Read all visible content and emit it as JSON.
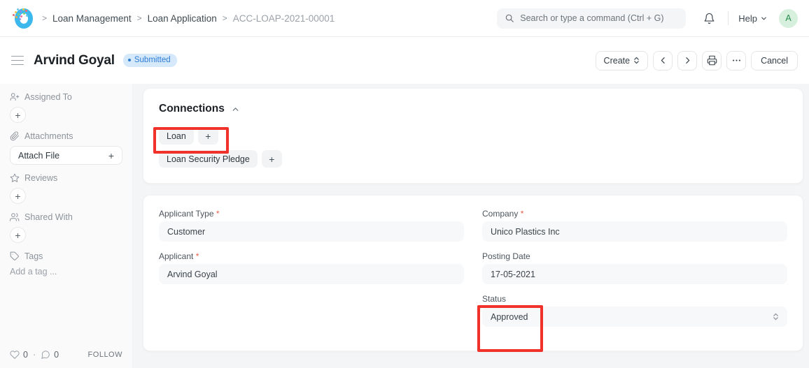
{
  "navbar": {
    "logo_icon": "frappe-logo-icon",
    "breadcrumbs": [
      {
        "label": "Loan Management",
        "muted": false
      },
      {
        "label": "Loan Application",
        "muted": false
      },
      {
        "label": "ACC-LOAP-2021-00001",
        "muted": true
      }
    ],
    "search": {
      "icon": "search-icon",
      "placeholder": "Search or type a command (Ctrl + G)",
      "value": ""
    },
    "notification_icon": "bell-icon",
    "help_label": "Help",
    "help_chevron_icon": "chevron-down-icon",
    "avatar_initial": "A"
  },
  "titlebar": {
    "menu_icon": "hamburger-icon",
    "title": "Arvind Goyal",
    "status_badge": "Submitted",
    "badge_color": "#2b7cd3",
    "badge_bg": "#d6e9fb",
    "actions": {
      "create_label": "Create",
      "create_chevron_icon": "up-down-chevron-icon",
      "prev_icon": "chevron-left-icon",
      "next_icon": "chevron-right-icon",
      "print_icon": "printer-icon",
      "more_icon": "ellipsis-icon",
      "cancel_label": "Cancel"
    }
  },
  "sidebar": {
    "sections": [
      {
        "label": "Assigned To",
        "icon": "user-plus-icon",
        "control": "plus-circle",
        "plus_label": "+"
      },
      {
        "label": "Attachments",
        "icon": "paperclip-icon",
        "control": "attach-file",
        "attach_label": "Attach File",
        "plus_label": "+"
      },
      {
        "label": "Reviews",
        "icon": "star-icon",
        "control": "plus-circle",
        "plus_label": "+"
      },
      {
        "label": "Shared With",
        "icon": "users-icon",
        "control": "plus-circle",
        "plus_label": "+"
      },
      {
        "label": "Tags",
        "icon": "tag-icon",
        "control": "add-tag",
        "add_tag_label": "Add a tag ..."
      }
    ],
    "footer": {
      "like_icon": "heart-icon",
      "like_count": "0",
      "separator": "·",
      "comment_icon": "comment-icon",
      "comment_count": "0",
      "follow_label": "FOLLOW"
    }
  },
  "connections": {
    "title": "Connections",
    "collapse_icon": "chevron-up-icon",
    "rows": [
      {
        "label": "Loan",
        "plus_label": "+"
      },
      {
        "label": "Loan Security Pledge",
        "plus_label": "+"
      }
    ]
  },
  "form": {
    "fields": [
      {
        "label": "Applicant Type",
        "required": true,
        "value": "Customer",
        "type": "link"
      },
      {
        "label": "Company",
        "required": true,
        "value": "Unico Plastics Inc",
        "type": "link"
      },
      {
        "label": "Applicant",
        "required": true,
        "value": "Arvind Goyal",
        "type": "link"
      },
      {
        "label": "Posting Date",
        "required": false,
        "value": "17-05-2021",
        "type": "date"
      },
      {
        "label": "Status",
        "required": false,
        "value": "Approved",
        "type": "select",
        "select_icon": "up-down-chevron-icon"
      }
    ]
  },
  "annotations": {
    "color": "#f1322a",
    "boxes": [
      {
        "name": "loan-connection-highlight"
      },
      {
        "name": "status-field-highlight"
      }
    ]
  }
}
